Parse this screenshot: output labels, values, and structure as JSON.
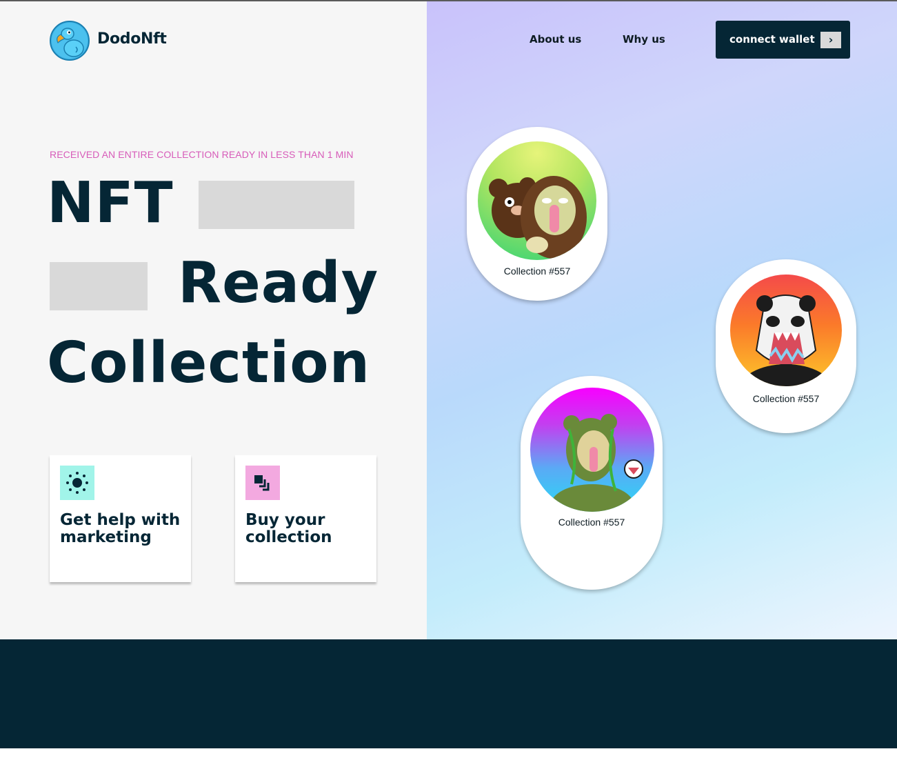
{
  "header": {
    "brand": "DodoNft",
    "nav": [
      "About us",
      "Why us"
    ],
    "wallet_button": "connect wallet",
    "wallet_arrow": "›"
  },
  "hero": {
    "eyebrow": "RECEIVED AN ENTIRE COLLECTION READY IN LESS THAN 1 MIN",
    "words": [
      "NFT",
      "Ready",
      "Collection"
    ]
  },
  "cards": [
    {
      "title": "Get help with marketing",
      "icon": "sun-icon"
    },
    {
      "title": "Buy your collection",
      "icon": "stack-squares-icon"
    }
  ],
  "nfts": [
    {
      "label": "Collection #557",
      "art": "bear-zombie-art"
    },
    {
      "label": "Collection #557",
      "art": "panda-zombie-art"
    },
    {
      "label": "Collection #557",
      "art": "plant-bear-art"
    }
  ],
  "colors": {
    "primary": "#052635",
    "accent_pink": "#d75bb9",
    "card_icon_teal": "#a1f4e9",
    "card_icon_pink": "#f3a9e0",
    "placeholder": "#d9d9d9"
  }
}
